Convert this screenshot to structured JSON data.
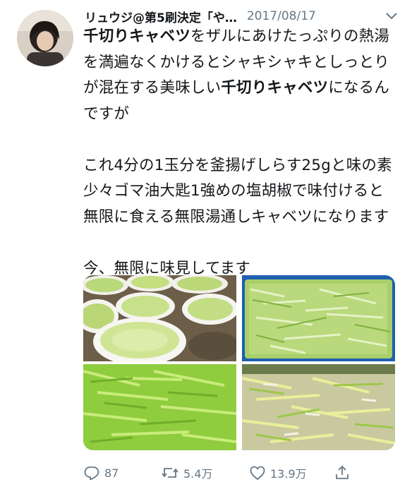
{
  "tweet": {
    "display_name": "リュウジ@第5刷決定「や…",
    "date": "2017/08/17",
    "text_parts": [
      {
        "text": "千切りキャベツ",
        "bold": true
      },
      {
        "text": "をザルにあけたっぷりの熱湯を満遍なくかけるとシャキシャキとしっとりが混在する美味しい",
        "bold": false
      },
      {
        "text": "千切りキャベツ",
        "bold": true
      },
      {
        "text": "になるんですが\n\nこれ4分の1玉分を釜揚げしらす25gと味の素少々ゴマ油大匙1強めの塩胡椒で味付けると無限に食える無限湯通しキャベツになります\n\n今、無限に味見してます",
        "bold": false
      }
    ]
  },
  "media": {
    "photos": [
      {
        "name": "cabbage-bowls-photo"
      },
      {
        "name": "shredded-cabbage-tray-photo"
      },
      {
        "name": "green-cabbage-closeup-photo"
      },
      {
        "name": "seasoned-cabbage-closeup-photo"
      }
    ]
  },
  "actions": {
    "reply_count": "87",
    "retweet_count": "5.4万",
    "like_count": "13.9万"
  },
  "icons": {
    "more": "chevron-down-icon",
    "reply": "reply-icon",
    "retweet": "retweet-icon",
    "like": "heart-icon",
    "share": "share-icon"
  },
  "colors": {
    "text": "#14171a",
    "secondary": "#657786",
    "cabbage_green": "#a9d55a",
    "tray_blue": "#1e5fb0"
  }
}
